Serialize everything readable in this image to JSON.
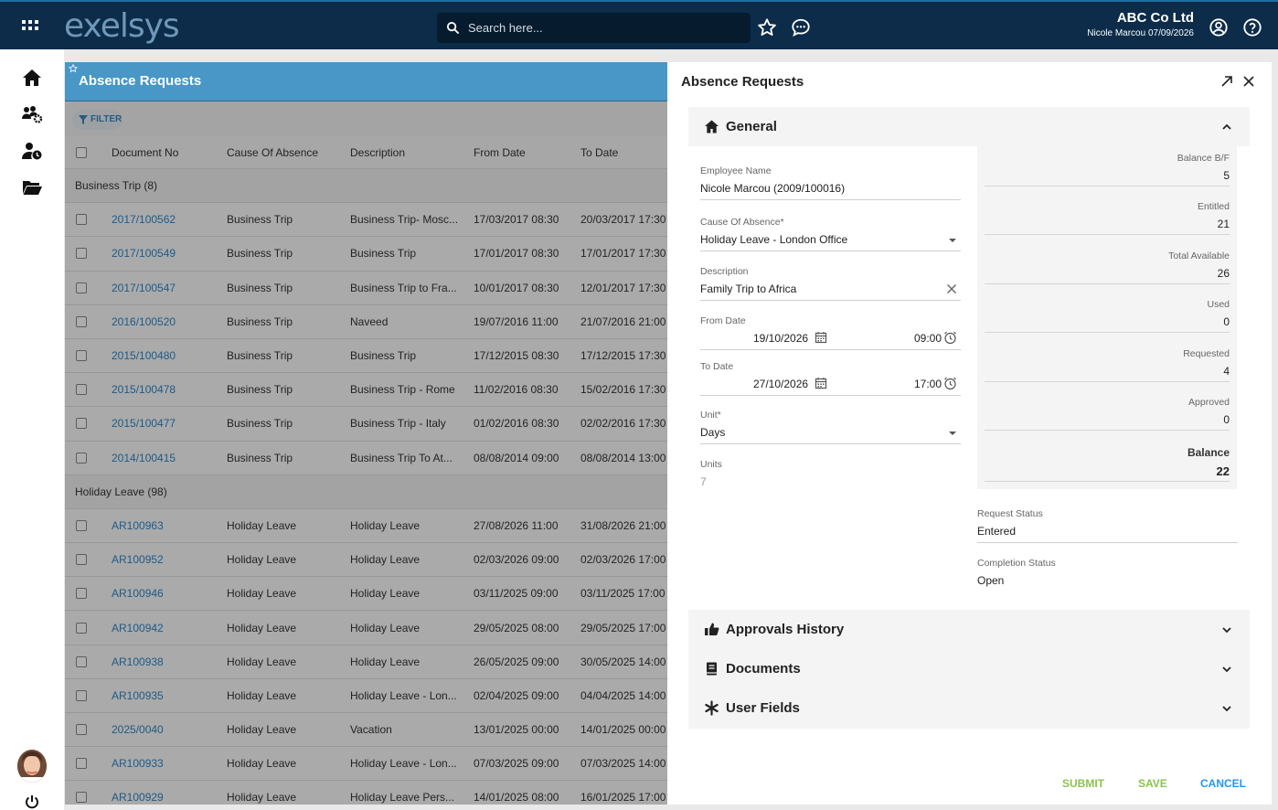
{
  "topbar": {
    "logo": "exelsys",
    "search_placeholder": "Search here...",
    "company": "ABC Co Ltd",
    "user_line": "Nicole Marcou 07/09/2026"
  },
  "list": {
    "title": "Absence Requests",
    "filter_label": "FILTER",
    "columns": [
      "Document No",
      "Cause Of Absence",
      "Description",
      "From Date",
      "To Date"
    ],
    "groups": [
      {
        "label": "Business Trip (8)",
        "rows": [
          {
            "doc": "2017/100562",
            "cause": "Business Trip",
            "desc": "Business Trip- Mosc...",
            "from": "17/03/2017 08:30",
            "to": "20/03/2017 17:30"
          },
          {
            "doc": "2017/100549",
            "cause": "Business Trip",
            "desc": "Business Trip",
            "from": "17/01/2017 08:30",
            "to": "17/01/2017 17:30"
          },
          {
            "doc": "2017/100547",
            "cause": "Business Trip",
            "desc": "Business Trip to Fra...",
            "from": "10/01/2017 08:30",
            "to": "12/01/2017 17:30"
          },
          {
            "doc": "2016/100520",
            "cause": "Business Trip",
            "desc": "Naveed",
            "from": "19/07/2016 11:00",
            "to": "21/07/2016 21:00"
          },
          {
            "doc": "2015/100480",
            "cause": "Business Trip",
            "desc": "Business Trip",
            "from": "17/12/2015 08:30",
            "to": "17/12/2015 17:30"
          },
          {
            "doc": "2015/100478",
            "cause": "Business Trip",
            "desc": "Business Trip - Rome",
            "from": "11/02/2016 08:30",
            "to": "15/02/2016 17:30"
          },
          {
            "doc": "2015/100477",
            "cause": "Business Trip",
            "desc": "Business Trip - Italy",
            "from": "01/02/2016 08:30",
            "to": "02/02/2016 17:30"
          },
          {
            "doc": "2014/100415",
            "cause": "Business Trip",
            "desc": "Business Trip To At...",
            "from": "08/08/2014 09:00",
            "to": "08/08/2014 13:00"
          }
        ]
      },
      {
        "label": "Holiday Leave (98)",
        "rows": [
          {
            "doc": "AR100963",
            "cause": "Holiday Leave",
            "desc": "Holiday Leave",
            "from": "27/08/2026 11:00",
            "to": "31/08/2026 21:00"
          },
          {
            "doc": "AR100952",
            "cause": "Holiday Leave",
            "desc": "Holiday Leave",
            "from": "02/03/2026 09:00",
            "to": "02/03/2026 17:00"
          },
          {
            "doc": "AR100946",
            "cause": "Holiday Leave",
            "desc": "Holiday Leave",
            "from": "03/11/2025 09:00",
            "to": "03/11/2025 17:00"
          },
          {
            "doc": "AR100942",
            "cause": "Holiday Leave",
            "desc": "Holiday Leave",
            "from": "29/05/2025 08:00",
            "to": "29/05/2025 17:00"
          },
          {
            "doc": "AR100938",
            "cause": "Holiday Leave",
            "desc": "Holiday Leave",
            "from": "26/05/2025 09:00",
            "to": "30/05/2025 14:00"
          },
          {
            "doc": "AR100935",
            "cause": "Holiday Leave",
            "desc": "Holiday Leave - Lon...",
            "from": "02/04/2025 09:00",
            "to": "04/04/2025 14:00"
          },
          {
            "doc": "2025/0040",
            "cause": "Holiday Leave",
            "desc": "Vacation",
            "from": "13/01/2025 00:00",
            "to": "14/01/2025 00:00"
          },
          {
            "doc": "AR100933",
            "cause": "Holiday Leave",
            "desc": "Holiday Leave - Lon...",
            "from": "07/03/2025 09:00",
            "to": "07/03/2025 14:00"
          },
          {
            "doc": "AR100929",
            "cause": "Holiday Leave",
            "desc": "Holiday Leave Pers...",
            "from": "14/01/2025 08:00",
            "to": "16/01/2025 17:00"
          }
        ]
      }
    ]
  },
  "detail": {
    "title": "Absence Requests",
    "general": {
      "label": "General",
      "employee_label": "Employee Name",
      "employee_value": "Nicole Marcou (2009/100016)",
      "cause_label": "Cause Of Absence*",
      "cause_value": "Holiday Leave - London Office",
      "desc_label": "Description",
      "desc_value": "Family Trip to Africa",
      "from_label": "From Date",
      "from_date": "19/10/2026",
      "from_time": "09:00",
      "to_label": "To Date",
      "to_date": "27/10/2026",
      "to_time": "17:00",
      "unit_label": "Unit*",
      "unit_value": "Days",
      "units_label": "Units",
      "units_value": "7"
    },
    "balance": [
      {
        "label": "Balance B/F",
        "value": "5"
      },
      {
        "label": "Entitled",
        "value": "21"
      },
      {
        "label": "Total Available",
        "value": "26"
      },
      {
        "label": "Used",
        "value": "0"
      },
      {
        "label": "Requested",
        "value": "4"
      },
      {
        "label": "Approved",
        "value": "0"
      },
      {
        "label": "Balance",
        "value": "22"
      }
    ],
    "request_status_label": "Request Status",
    "request_status_value": "Entered",
    "completion_status_label": "Completion Status",
    "completion_status_value": "Open",
    "sections": {
      "approvals": "Approvals History",
      "documents": "Documents",
      "user_fields": "User Fields"
    },
    "actions": {
      "submit": "SUBMIT",
      "save": "SAVE",
      "cancel": "CANCEL"
    }
  }
}
